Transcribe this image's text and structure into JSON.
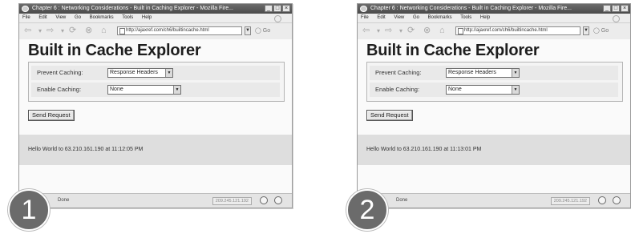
{
  "panels": [
    {
      "step": "1",
      "window_title": "Chapter 6 : Networking Considerations - Built in Caching Explorer - Mozilla Fire...",
      "menu": [
        "File",
        "Edit",
        "View",
        "Go",
        "Bookmarks",
        "Tools",
        "Help"
      ],
      "url": "http://ajaxref.com/ch6/builtincache.html",
      "page_title": "Built in Cache Explorer",
      "prevent_label": "Prevent Caching:",
      "prevent_value": "Response Headers",
      "enable_label": "Enable Caching:",
      "enable_value": "None",
      "send_button": "Send Request",
      "result": "Hello World to 63.210.161.190 at 11:12:05 PM",
      "status": "Done",
      "status_ip": "209.245.121.192"
    },
    {
      "step": "2",
      "window_title": "Chapter 6 : Networking Considerations - Built in Caching Explorer - Mozilla Fire...",
      "menu": [
        "File",
        "Edit",
        "View",
        "Go",
        "Bookmarks",
        "Tools",
        "Help"
      ],
      "url": "http://ajaxref.com/ch6/builtincache.html",
      "page_title": "Built in Cache Explorer",
      "prevent_label": "Prevent Caching:",
      "prevent_value": "Response Headers",
      "enable_label": "Enable Caching:",
      "enable_value": "None",
      "send_button": "Send Request",
      "result": "Hello World to 63.210.161.190 at 11:13:01 PM",
      "status": "Done",
      "status_ip": "209.245.121.192"
    }
  ],
  "icons": {
    "back": "back-arrow-icon",
    "forward": "forward-arrow-icon",
    "reload": "reload-icon",
    "stop": "stop-icon",
    "home": "home-icon",
    "go": "go-icon"
  }
}
